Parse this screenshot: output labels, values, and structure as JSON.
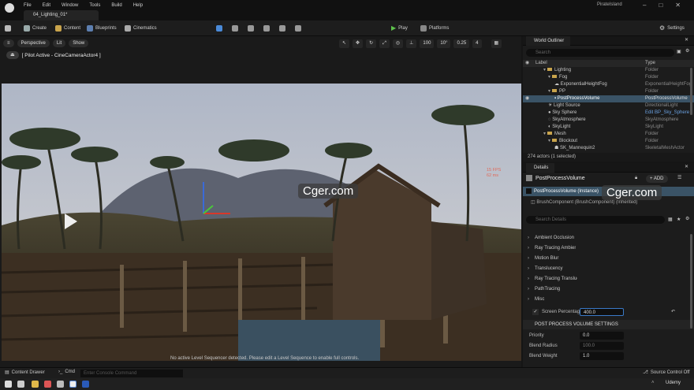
{
  "menu": [
    "File",
    "Edit",
    "Window",
    "Tools",
    "Build",
    "Help"
  ],
  "doc_tab": "04_Lighting_01*",
  "project_name": "PirateIsland",
  "toolbar": {
    "create": "Create",
    "content": "Content",
    "blueprints": "Blueprints",
    "cinematics": "Cinematics",
    "play": "Play",
    "platforms": "Platforms",
    "settings": "Settings"
  },
  "viewport": {
    "perspective": "Perspective",
    "lit": "Lit",
    "show": "Show",
    "grid_snap": "100",
    "rot_snap": "10°",
    "scale_snap": "0.25",
    "cam_speed": "4",
    "pilot": "[ Pilot Active - CineCameraActor4 ]",
    "fps": "15 FPS",
    "ms": "62 ms",
    "sequencer_msg": "No active Level Sequencer detected. Please edit a Level Sequence to enable full controls.",
    "watermark": "Cger.com"
  },
  "outliner": {
    "title": "World Outliner",
    "search_placeholder": "Search",
    "col_label": "Label",
    "col_type": "Type",
    "rows": [
      {
        "name": "Lighting",
        "type": "Folder"
      },
      {
        "name": "Fog",
        "type": "Folder"
      },
      {
        "name": "ExponentialHeightFog",
        "type": "ExponentialHeightFog"
      },
      {
        "name": "PP",
        "type": "Folder"
      },
      {
        "name": "PostProcessVolume",
        "type": "PostProcessVolume"
      },
      {
        "name": "Light Source",
        "type": "DirectionalLight"
      },
      {
        "name": "Sky Sphere",
        "type": "Edit BP_Sky_Sphere"
      },
      {
        "name": "SkyAtmosphere",
        "type": "SkyAtmosphere"
      },
      {
        "name": "SkyLight",
        "type": "SkyLight"
      },
      {
        "name": "Mesh",
        "type": "Folder"
      },
      {
        "name": "Blockout",
        "type": "Folder"
      },
      {
        "name": "SK_Mannequin2",
        "type": "SkeletalMeshActor"
      }
    ],
    "actors": "274 actors (1 selected)"
  },
  "details": {
    "title": "Details",
    "actor": "PostProcessVolume",
    "add": "+ ADD",
    "instance": "PostProcessVolume (Instance)",
    "component": "BrushComponent (BrushComponent) (Inherited)",
    "search_placeholder": "Search Details",
    "sections": [
      "Ambient Occlusion",
      "Ray Tracing Ambient Occlusion",
      "Motion Blur",
      "Translucency",
      "Ray Tracing Translucency",
      "PathTracing",
      "Misc"
    ],
    "screen_pct_label": "Screen Percentage",
    "screen_pct_value": "400.0",
    "ppv_header": "POST PROCESS VOLUME SETTINGS",
    "props": [
      {
        "label": "Priority",
        "value": "0.0"
      },
      {
        "label": "Blend Radius",
        "value": "100.0"
      },
      {
        "label": "Blend Weight",
        "value": "1.0"
      }
    ]
  },
  "status": {
    "content_drawer": "Content Drawer",
    "cmd": "Cmd",
    "console_placeholder": "Enter Console Command",
    "source_control": "Source Control Off"
  },
  "taskbar": {
    "right_text": "Udemy"
  }
}
